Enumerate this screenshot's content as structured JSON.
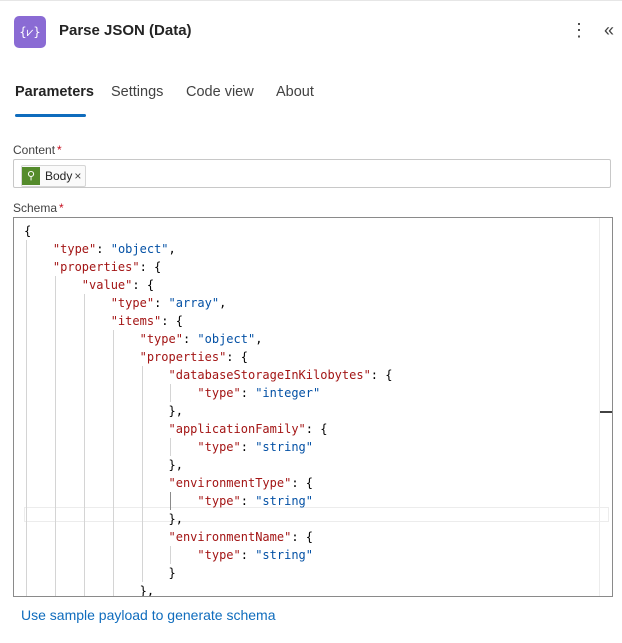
{
  "header": {
    "title": "Parse JSON (Data)",
    "icon_glyph": "{⩗}",
    "more_glyph": "⋮",
    "collapse_glyph": "«"
  },
  "tabs": [
    {
      "label": "Parameters",
      "active": true
    },
    {
      "label": "Settings",
      "active": false
    },
    {
      "label": "Code view",
      "active": false
    },
    {
      "label": "About",
      "active": false
    }
  ],
  "content_field": {
    "label": "Content",
    "required": "*",
    "token": {
      "label": "Body",
      "remove": "×",
      "icon": "lightbulb-icon"
    }
  },
  "schema_field": {
    "label": "Schema",
    "required": "*",
    "lines": [
      "{",
      "    \"type\": \"object\",",
      "    \"properties\": {",
      "        \"value\": {",
      "            \"type\": \"array\",",
      "            \"items\": {",
      "                \"type\": \"object\",",
      "                \"properties\": {",
      "                    \"databaseStorageInKilobytes\": {",
      "                        \"type\": \"integer\"",
      "                    },",
      "                    \"applicationFamily\": {",
      "                        \"type\": \"string\"",
      "                    },",
      "                    \"environmentType\": {",
      "                        \"type\": \"string\"",
      "                    },",
      "                    \"environmentName\": {",
      "                        \"type\": \"string\"",
      "                    }",
      "                },"
    ]
  },
  "footer": {
    "link": "Use sample payload to generate schema"
  },
  "colors": {
    "accent": "#0f6cbd",
    "app_icon": "#8a6bd4",
    "token_icon": "#548b2b",
    "json_key": "#a31515",
    "json_string": "#0451a5"
  }
}
